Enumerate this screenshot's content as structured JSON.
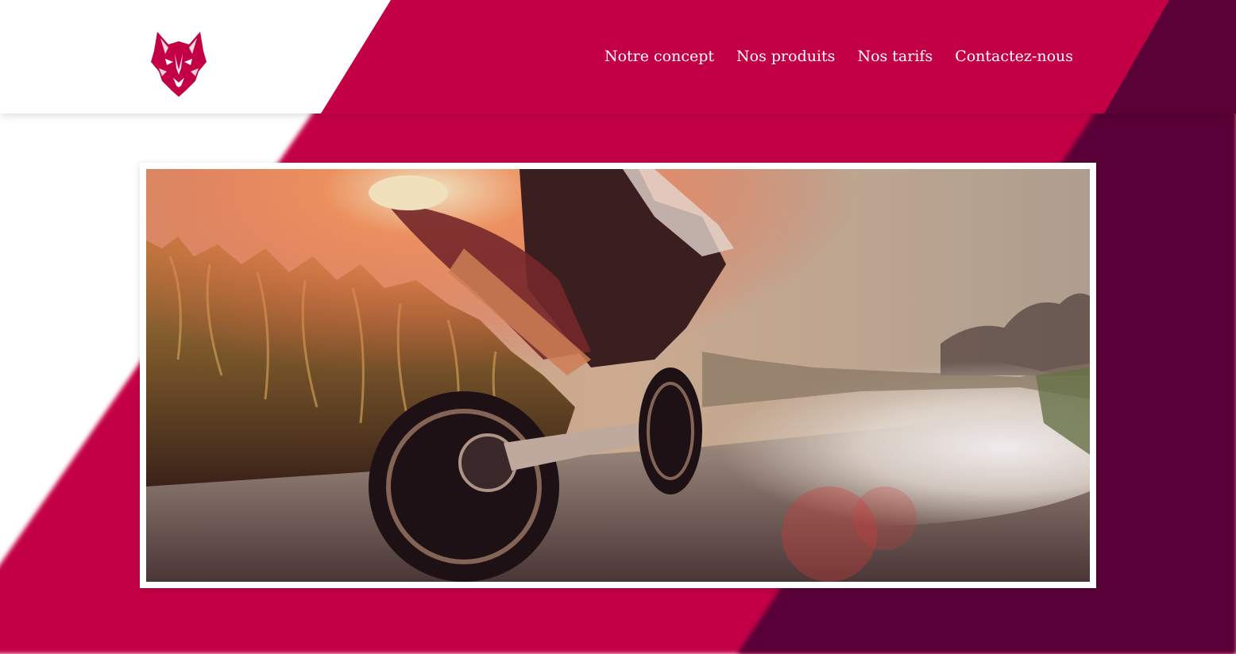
{
  "colors": {
    "crimson": "#C40044",
    "wine": "#5A0138",
    "white": "#FFFFFF"
  },
  "header": {
    "logo_icon": "wolf-head-icon",
    "nav": [
      {
        "label": "Notre concept"
      },
      {
        "label": "Nos produits"
      },
      {
        "label": "Nos tarifs"
      },
      {
        "label": "Contactez-nous"
      }
    ]
  },
  "hero": {
    "image": "motorcycle-night-road-photo"
  }
}
